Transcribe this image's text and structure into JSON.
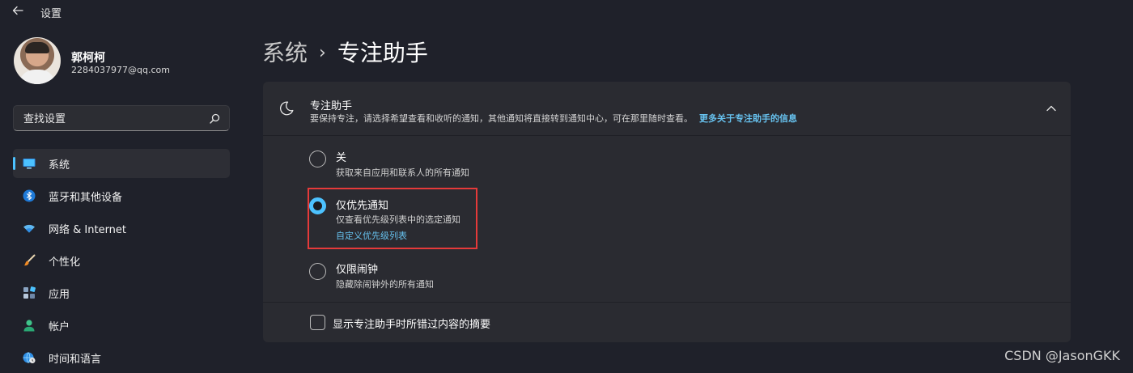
{
  "window": {
    "title": "设置"
  },
  "user": {
    "name": "郭柯柯",
    "email": "2284037977@qq.com"
  },
  "search": {
    "placeholder": "查找设置"
  },
  "sidebar": {
    "items": [
      {
        "label": "系统",
        "icon": "monitor-icon",
        "active": true
      },
      {
        "label": "蓝牙和其他设备",
        "icon": "bluetooth-icon"
      },
      {
        "label": "网络 & Internet",
        "icon": "wifi-icon"
      },
      {
        "label": "个性化",
        "icon": "brush-icon"
      },
      {
        "label": "应用",
        "icon": "apps-icon"
      },
      {
        "label": "帐户",
        "icon": "person-icon"
      },
      {
        "label": "时间和语言",
        "icon": "globe-clock-icon"
      }
    ]
  },
  "breadcrumb": {
    "parent": "系统",
    "separator": "›",
    "current": "专注助手"
  },
  "focus_panel": {
    "title": "专注助手",
    "description": "要保持专注，请选择希望查看和收听的通知，其他通知将直接转到通知中心，可在那里随时查看。",
    "learn_more_link": "更多关于专注助手的信息",
    "options": [
      {
        "title": "关",
        "desc": "获取来自应用和联系人的所有通知",
        "checked": false
      },
      {
        "title": "仅优先通知",
        "desc": "仅查看优先级列表中的选定通知",
        "link": "自定义优先级列表",
        "checked": true
      },
      {
        "title": "仅限闹钟",
        "desc": "隐藏除闹钟外的所有通知",
        "checked": false
      }
    ],
    "checkbox": {
      "label": "显示专注助手时所错过内容的摘要",
      "checked": false
    }
  },
  "watermark": "CSDN @JasonGKK",
  "colors": {
    "accent": "#4cc2ff",
    "link": "#67c2ef",
    "highlight": "#e53a3a",
    "background": "#1f212a",
    "panel": "#2a2b31"
  }
}
